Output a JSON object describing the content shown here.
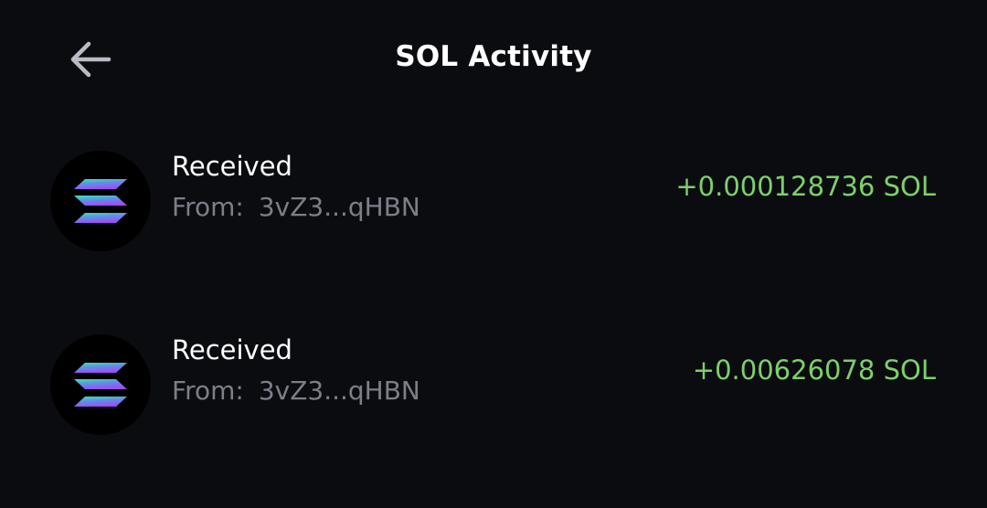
{
  "header": {
    "title": "SOL Activity"
  },
  "colors": {
    "background": "#0b0c10",
    "amount_positive": "#7dd06a",
    "muted_text": "#7c7f88"
  },
  "transactions": [
    {
      "type": "Received",
      "from_label": "From:",
      "address": "3vZ3...qHBN",
      "amount": "+0.000128736 SOL",
      "icon": "solana-logo-icon"
    },
    {
      "type": "Received",
      "from_label": "From:",
      "address": "3vZ3...qHBN",
      "amount": "+0.00626078 SOL",
      "icon": "solana-logo-icon"
    }
  ]
}
